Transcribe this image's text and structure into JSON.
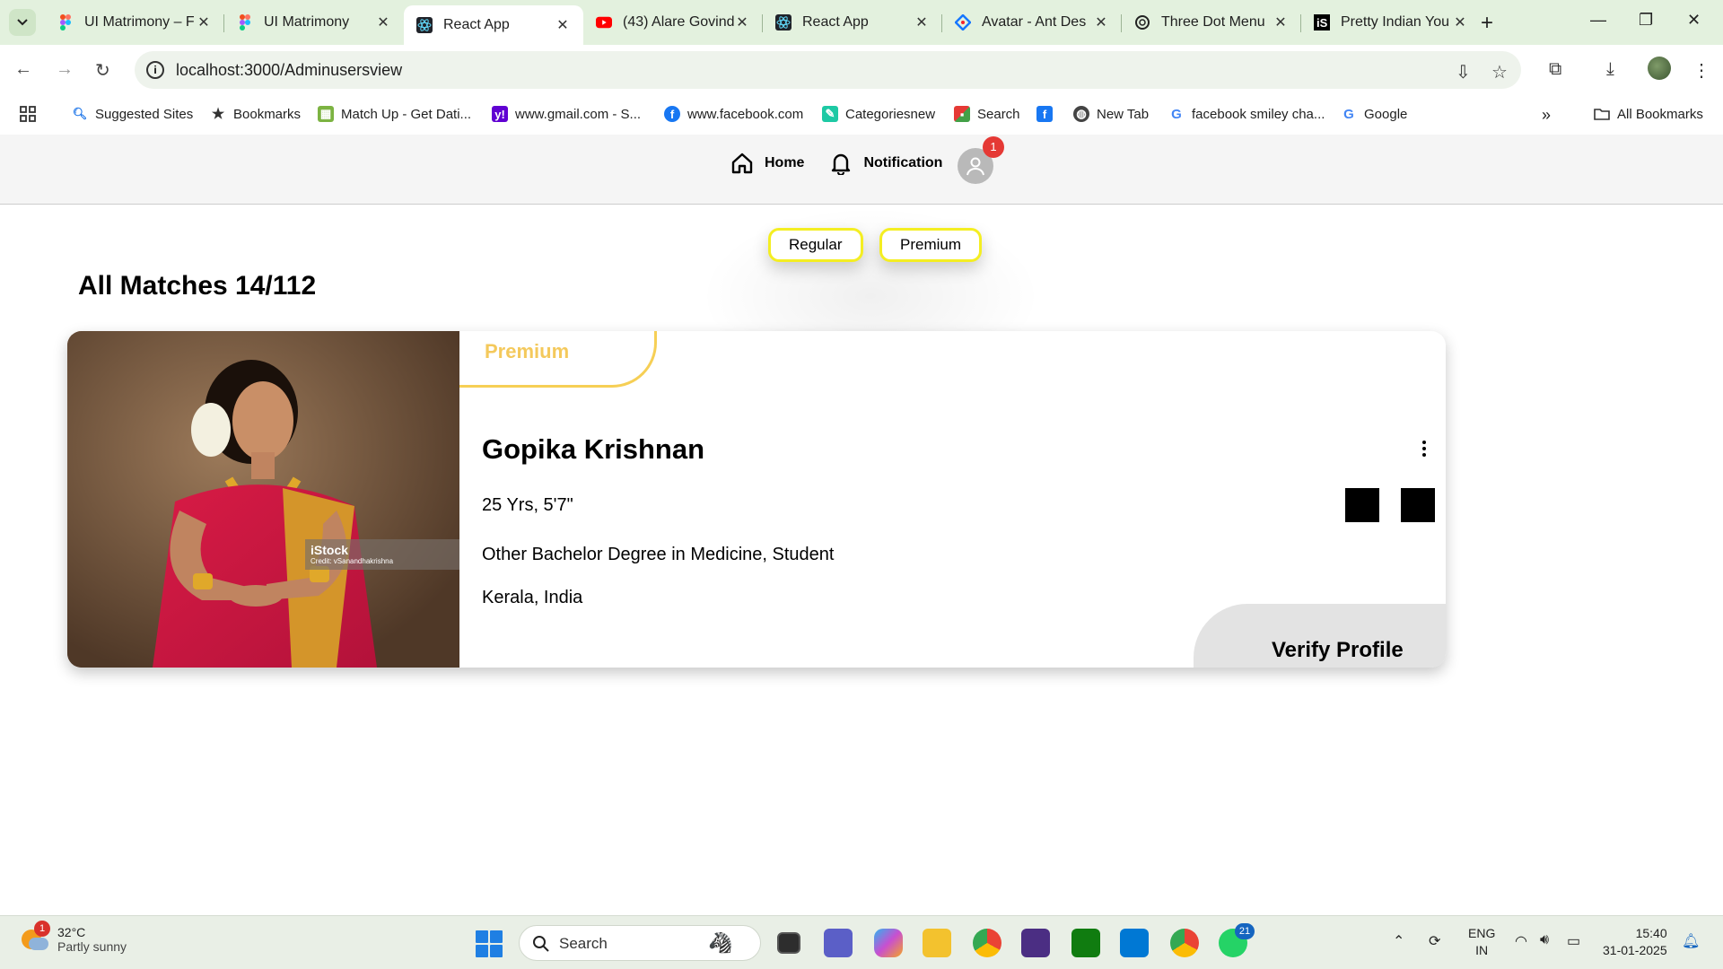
{
  "browser": {
    "tabs": [
      {
        "title": "UI Matrimony – F",
        "favicon": "figma-icon",
        "active": false
      },
      {
        "title": "UI Matrimony",
        "favicon": "figma-icon",
        "active": false
      },
      {
        "title": "React App",
        "favicon": "react-icon",
        "active": true
      },
      {
        "title": "(43) Alare Govind",
        "favicon": "youtube-icon",
        "active": false
      },
      {
        "title": "React App",
        "favicon": "react-icon",
        "active": false
      },
      {
        "title": "Avatar - Ant Des",
        "favicon": "antd-icon",
        "active": false
      },
      {
        "title": "Three Dot Menu",
        "favicon": "openai-icon",
        "active": false
      },
      {
        "title": "Pretty Indian You",
        "favicon": "istock-icon",
        "active": false
      }
    ],
    "url": "localhost:3000/Adminusersview",
    "bookmarks": [
      {
        "label": "Suggested Sites",
        "icon": "search-icon"
      },
      {
        "label": "Bookmarks",
        "icon": "star-icon"
      },
      {
        "label": "Match Up - Get Dati...",
        "icon": "matchup-icon"
      },
      {
        "label": "www.gmail.com - S...",
        "icon": "yahoo-icon"
      },
      {
        "label": "www.facebook.com",
        "icon": "facebook-icon"
      },
      {
        "label": "Categoriesnew",
        "icon": "categories-icon"
      },
      {
        "label": "Search",
        "icon": "search-app-icon"
      },
      {
        "label": "New Tab",
        "icon": "globe-icon"
      },
      {
        "label": "facebook smiley cha...",
        "icon": "google-icon"
      },
      {
        "label": "Google",
        "icon": "google-icon"
      }
    ],
    "all_bookmarks": "All Bookmarks"
  },
  "app": {
    "nav": {
      "home": "Home",
      "notification": "Notification",
      "notification_count": "1"
    },
    "filters": [
      "Regular",
      "Premium"
    ],
    "heading": "All Matches 14/112",
    "profile": {
      "tier": "Premium",
      "name": "Gopika Krishnan",
      "age_height": "25 Yrs, 5'7\"",
      "education": "Other Bachelor Degree in Medicine, Student",
      "location": "Kerala, India",
      "verify_label": "Verify Profile",
      "photo_watermark": "iStock",
      "photo_credit": "Credit: vSanandhakrishna"
    },
    "colors": {
      "premium_accent": "#f4c95c",
      "filter_border": "#f4ee22",
      "badge_red": "#e53935"
    }
  },
  "taskbar": {
    "weather_temp": "32°C",
    "weather_desc": "Partly sunny",
    "weather_badge": "1",
    "search_label": "Search",
    "whatsapp_badge": "21",
    "lang_line1": "ENG",
    "lang_line2": "IN",
    "time": "15:40",
    "date": "31-01-2025"
  }
}
